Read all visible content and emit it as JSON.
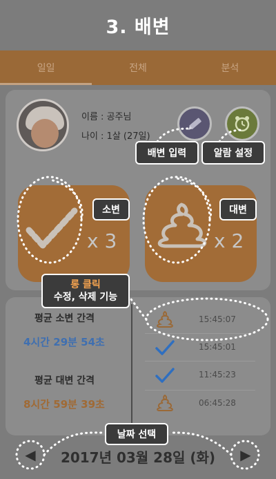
{
  "header": {
    "title": "3. 배변"
  },
  "tabs": [
    {
      "label": "일일"
    },
    {
      "label": "전체"
    },
    {
      "label": "분석"
    }
  ],
  "profile": {
    "name_line": "이름 : 공주님",
    "age_line": "나이 : 1살 (27일)"
  },
  "callouts": {
    "poop_input": "배변 입력",
    "alarm_setting": "알람 설정",
    "urine": "소변",
    "stool": "대변",
    "long_click_title": "롱 클릭",
    "long_click_desc": "수정, 삭제 기능",
    "date_select": "날짜 선택"
  },
  "counters": {
    "urine_count": "x 3",
    "stool_count": "x 2"
  },
  "stats": {
    "urine_interval_label": "평균 소변 간격",
    "urine_interval_value": "4시간 29분 54초",
    "stool_interval_label": "평균 대변 간격",
    "stool_interval_value": "8시간 59분 39초"
  },
  "log": [
    {
      "type": "poop-icon",
      "time": "15:45:07"
    },
    {
      "type": "check-icon",
      "time": "15:45:01"
    },
    {
      "type": "check-icon",
      "time": "11:45:23"
    },
    {
      "type": "poop-icon",
      "time": "06:45:28"
    }
  ],
  "date_nav": {
    "date": "2017년 03월 28일 (화)",
    "prev": "◀",
    "next": "▶"
  },
  "colors": {
    "accent_brown": "#a26c37",
    "urine_blue": "#3f6fb0",
    "stool_brown": "#a06a35",
    "overlay_gray": "#7c7c7c"
  }
}
